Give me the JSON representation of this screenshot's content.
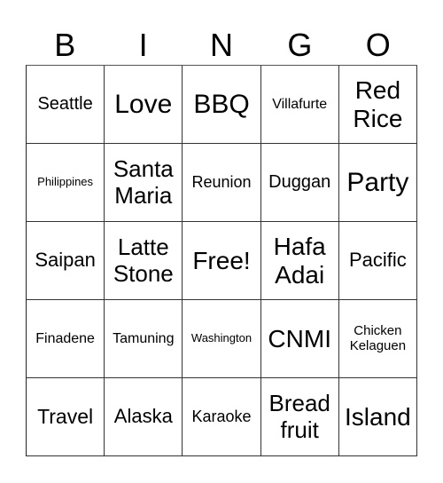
{
  "header": {
    "letters": [
      "B",
      "I",
      "N",
      "G",
      "O"
    ]
  },
  "grid": {
    "rows": [
      [
        "Seattle",
        "Love",
        "BBQ",
        "Villafurte",
        "Red\nRice"
      ],
      [
        "Philippines",
        "Santa\nMaria",
        "Reunion",
        "Duggan",
        "Party"
      ],
      [
        "Saipan",
        "Latte\nStone",
        "Free!",
        "Hafa\nAdai",
        "Pacific"
      ],
      [
        "Finadene",
        "Tamuning",
        "Washington",
        "CNMI",
        "Chicken\nKelaguen"
      ],
      [
        "Travel",
        "Alaska",
        "Karaoke",
        "Bread\nfruit",
        "Island"
      ]
    ]
  }
}
